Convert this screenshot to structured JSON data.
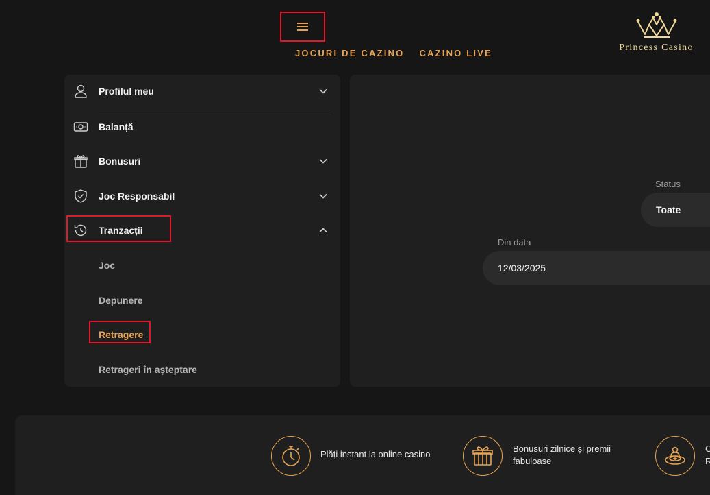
{
  "header": {
    "nav": [
      "JOCURI DE CAZINO",
      "CAZINO LIVE"
    ],
    "logo_text": "Princess Casino"
  },
  "sidebar": {
    "items": [
      {
        "label": "Profilul meu",
        "icon": "user-icon",
        "chevron": "down"
      },
      {
        "label": "Balanță",
        "icon": "money-icon",
        "chevron": "none"
      },
      {
        "label": "Bonusuri",
        "icon": "gift-icon",
        "chevron": "down"
      },
      {
        "label": "Joc Responsabil",
        "icon": "shield-icon",
        "chevron": "down"
      },
      {
        "label": "Tranzacții",
        "icon": "history-icon",
        "chevron": "up"
      }
    ],
    "sub_items": [
      "Joc",
      "Depunere",
      "Retragere",
      "Retrageri în așteptare"
    ],
    "active_sub": "Retragere"
  },
  "filters": {
    "status_label": "Status",
    "status_value": "Toate",
    "from_label": "Din data",
    "from_value": "12/03/2025"
  },
  "footer": {
    "features": [
      {
        "text": "Plăți instant la online casino",
        "icon": "stopwatch-icon"
      },
      {
        "text": "Bonusuri zilnice și premii fabuloase",
        "icon": "gift-icon"
      },
      {
        "text": "C\nR",
        "icon": "dealer-icon"
      }
    ]
  },
  "colors": {
    "accent": "#e8a352",
    "highlight": "#e0192a",
    "panel": "#1f1f1f",
    "background": "#161616"
  }
}
